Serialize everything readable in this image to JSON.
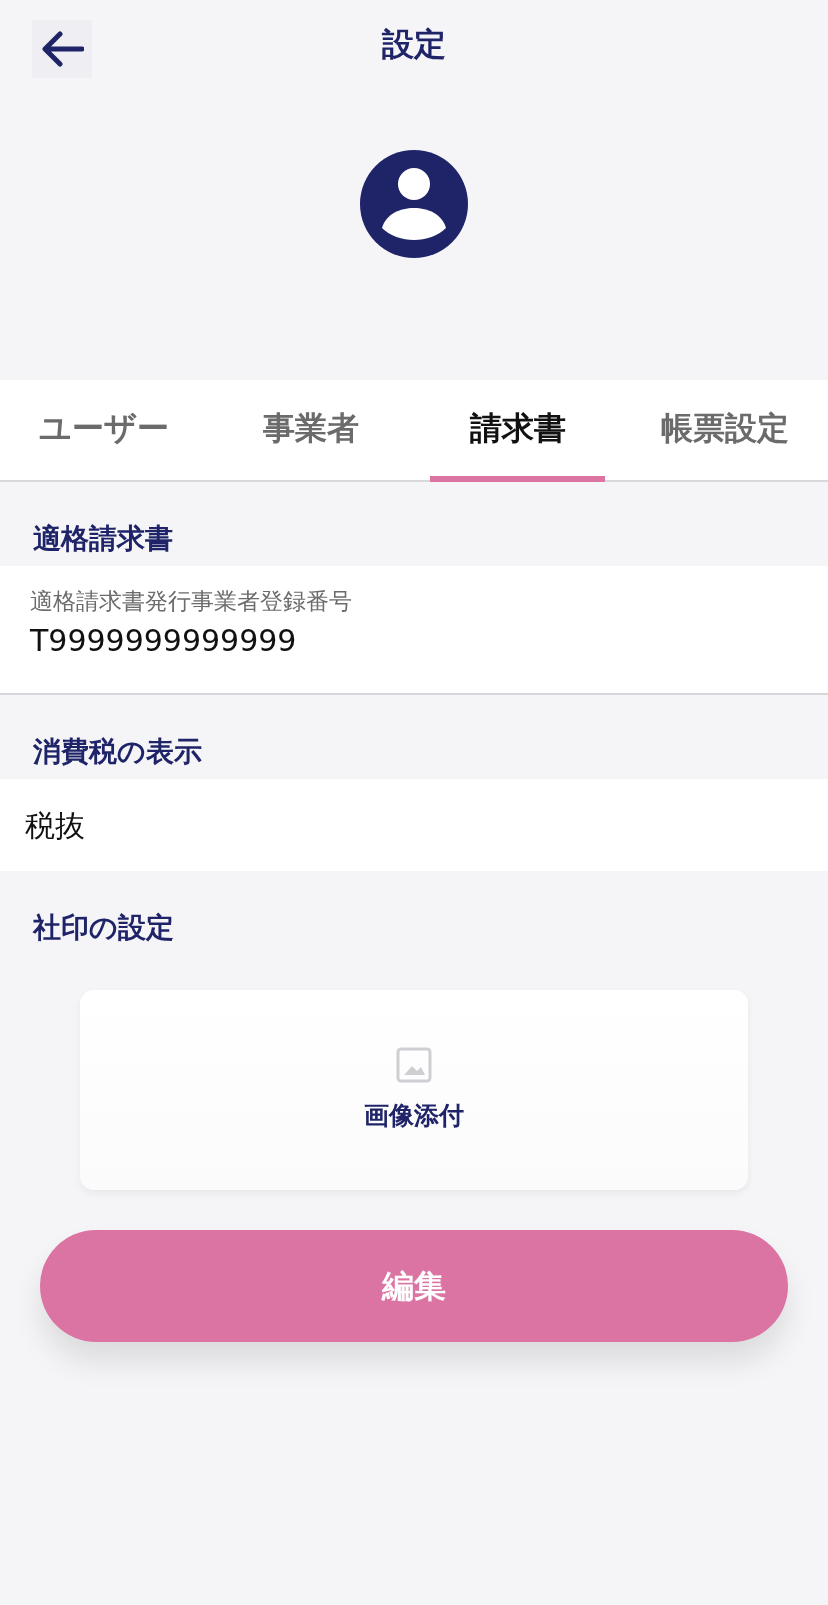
{
  "header": {
    "title": "設定"
  },
  "tabs": [
    {
      "label": "ユーザー",
      "selected": false
    },
    {
      "label": "事業者",
      "selected": false
    },
    {
      "label": "請求書",
      "selected": true
    },
    {
      "label": "帳票設定",
      "selected": false
    }
  ],
  "sections": [
    {
      "heading": "適格請求書",
      "kind": "field",
      "label": "適格請求書発行事業者登録番号",
      "value": "T9999999999999"
    },
    {
      "heading": "消費税の表示",
      "kind": "value",
      "value": "税抜"
    },
    {
      "heading": "社印の設定",
      "kind": "upload",
      "label": "画像添付"
    }
  ],
  "edit_button": "編集"
}
